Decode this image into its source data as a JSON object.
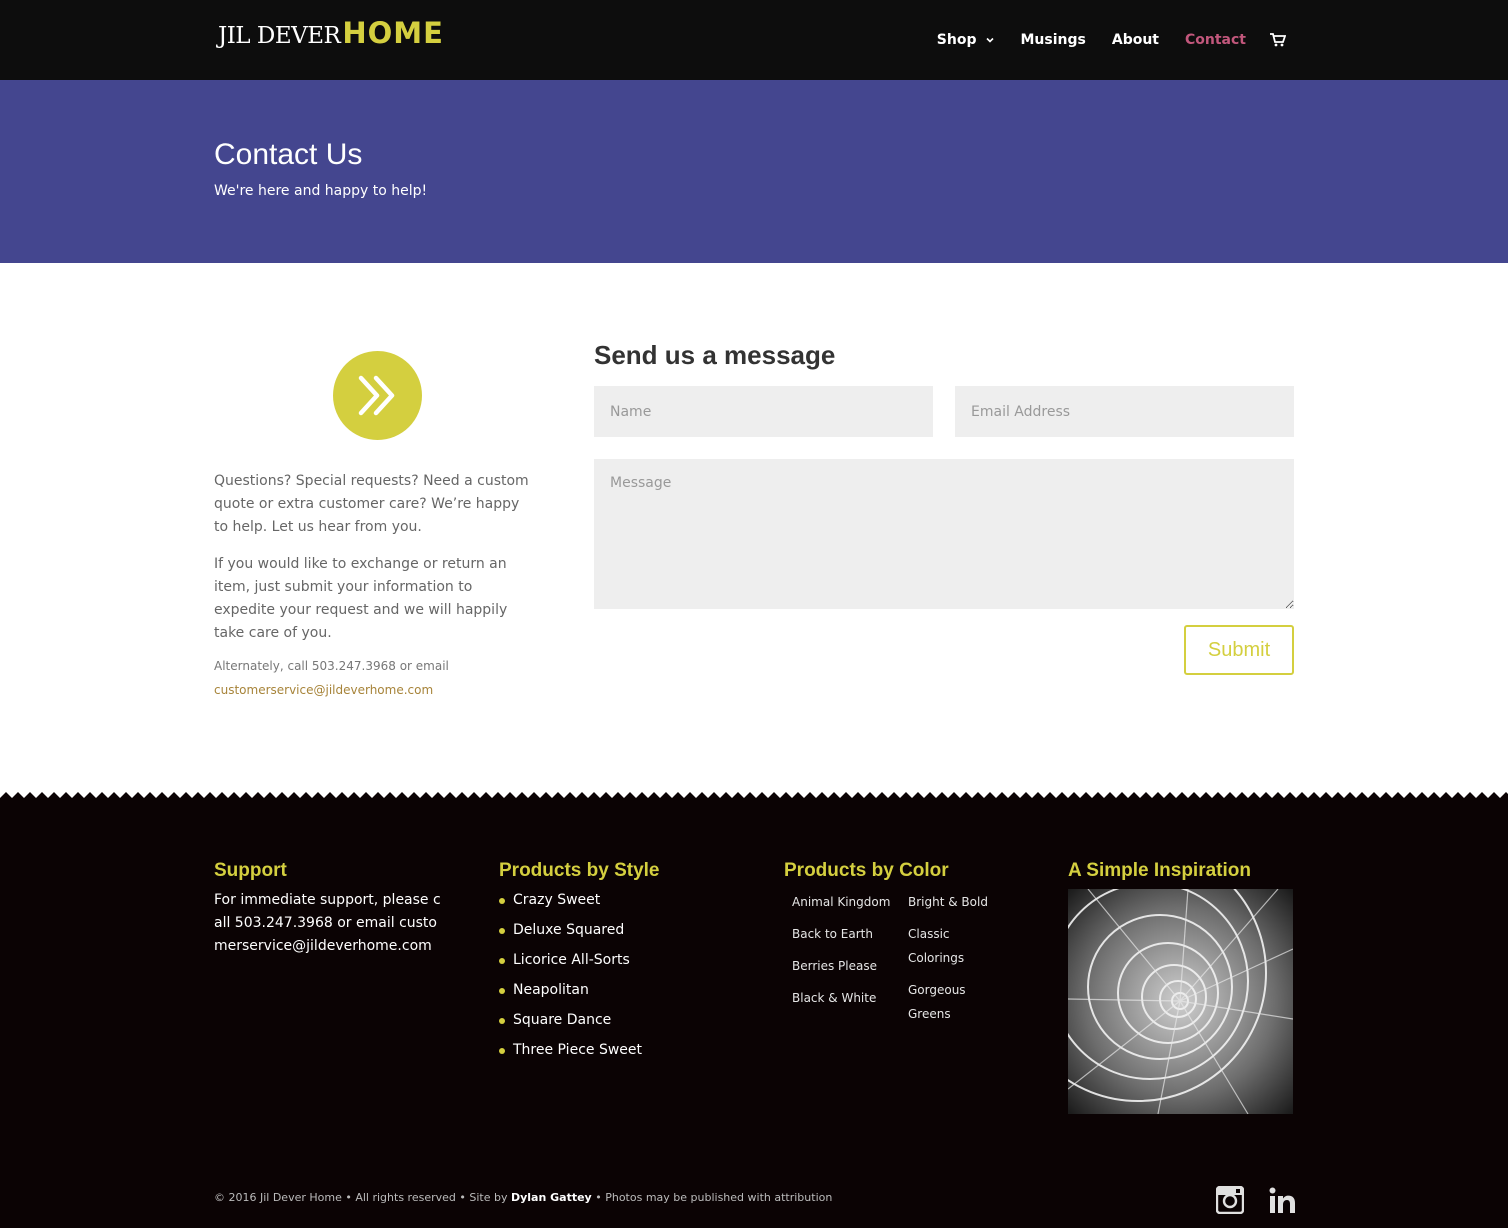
{
  "header": {
    "logo_serif": "JIL DEVER",
    "logo_home": "HOME",
    "nav": [
      {
        "label": "Shop"
      },
      {
        "label": "Musings"
      },
      {
        "label": "About"
      },
      {
        "label": "Contact"
      }
    ]
  },
  "hero": {
    "title": "Contact Us",
    "subtitle": "We're here and happy to help!"
  },
  "content": {
    "para1": "Questions? Special requests? Need a custom quote or extra customer care? We’re happy to help. Let us hear from you.",
    "para2": "If you would like to exchange or return an item, just submit your information to expedite your request and we will happily take care of you.",
    "alt_text": "Alternately, call 503.247.3968 or email",
    "alt_email": "customerservice@jildeverhome.com"
  },
  "form": {
    "title": "Send us a message",
    "name_placeholder": "Name",
    "email_placeholder": "Email Address",
    "message_placeholder": "Message",
    "submit_label": "Submit"
  },
  "footer": {
    "support": {
      "heading": "Support",
      "text": "For immediate support, please call 503.247.3968 or email customerservice@jildeverhome.com"
    },
    "styles": {
      "heading": "Products by Style",
      "items": [
        "Crazy Sweet",
        "Deluxe Squared",
        "Licorice All-Sorts",
        "Neapolitan",
        "Square Dance",
        "Three Piece Sweet"
      ]
    },
    "colors": {
      "heading": "Products by Color",
      "col1": [
        "Animal Kingdom",
        "Back to Earth",
        "Berries Please",
        "Black & White"
      ],
      "col2": [
        "Bright & Bold",
        "Classic Colorings",
        "Gorgeous Greens"
      ]
    },
    "inspiration": {
      "heading": "A Simple Inspiration"
    },
    "copyright_prefix": "© 2016 Jil Dever Home • All rights reserved • Site by ",
    "copyright_author": "Dylan Gattey",
    "copyright_suffix": " • Photos may be published with attribution"
  },
  "colors": {
    "accent": "#d4cf3f",
    "hero_bg": "#44468f",
    "active_nav": "#c2577c",
    "footer_bg": "#0b0304"
  },
  "icons": [
    "chevron-down-icon",
    "cart-icon",
    "double-chevron-right-icon",
    "instagram-icon",
    "linkedin-icon"
  ]
}
